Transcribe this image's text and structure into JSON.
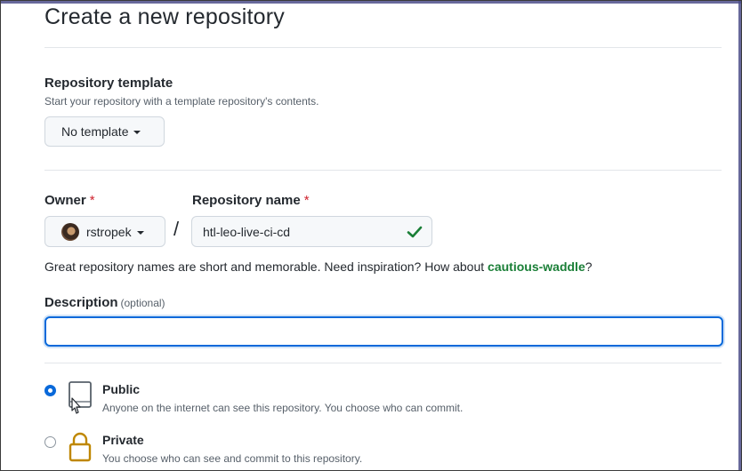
{
  "page": {
    "title": "Create a new repository"
  },
  "template": {
    "label": "Repository template",
    "description": "Start your repository with a template repository's contents.",
    "button_label": "No template"
  },
  "owner": {
    "label": "Owner",
    "required_mark": "*",
    "value": "rstropek"
  },
  "repo_name": {
    "label": "Repository name",
    "required_mark": "*",
    "value": "htl-leo-live-ci-cd",
    "separator": "/",
    "valid": true
  },
  "hint": {
    "text": "Great repository names are short and memorable. Need inspiration? How about ",
    "suggestion": "cautious-waddle",
    "suffix": "?"
  },
  "description": {
    "label": "Description",
    "optional_label": "(optional)",
    "value": ""
  },
  "visibility": {
    "options": [
      {
        "title": "Public",
        "description": "Anyone on the internet can see this repository. You choose who can commit.",
        "icon": "repo-icon",
        "selected": true
      },
      {
        "title": "Private",
        "description": "You choose who can see and commit to this repository.",
        "icon": "lock-icon",
        "selected": false
      }
    ]
  },
  "colors": {
    "accent": "#0969da",
    "success": "#1a7f37",
    "required": "#cf222e",
    "lock": "#bf8700"
  }
}
